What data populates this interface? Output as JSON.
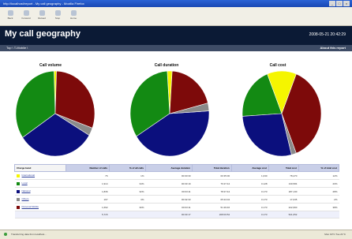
{
  "window": {
    "title": "http://localhost/report - My call geography - Mozilla Firefox",
    "controls": [
      "_",
      "□",
      "×"
    ]
  },
  "toolbar": {
    "buttons": [
      "Back",
      "Forward",
      "Reload",
      "Stop",
      "Home"
    ]
  },
  "header": {
    "title": "My call geography",
    "timestamp": "2008-05-21 20:42:29"
  },
  "nav": {
    "breadcrumb": "Top \\ T-Mobile \\",
    "about": "About this report"
  },
  "colors": {
    "International": "#f5f500",
    "Local": "#138a13",
    "National": "#0b0f7d",
    "Others": "#8a8a8a",
    "Personal Mobile": "#7d0a0a"
  },
  "chart_data": [
    {
      "type": "pie",
      "title": "Call volume",
      "series": [
        {
          "name": "International",
          "value": 1
        },
        {
          "name": "Local",
          "value": 34
        },
        {
          "name": "National",
          "value": 32
        },
        {
          "name": "Others",
          "value": 3
        },
        {
          "name": "Personal Mobile",
          "value": 30
        }
      ]
    },
    {
      "type": "pie",
      "title": "Call duration",
      "series": [
        {
          "name": "International",
          "value": 2
        },
        {
          "name": "Local",
          "value": 33
        },
        {
          "name": "National",
          "value": 42
        },
        {
          "name": "Others",
          "value": 3
        },
        {
          "name": "Personal Mobile",
          "value": 20
        }
      ]
    },
    {
      "type": "pie",
      "title": "Call cost",
      "series": [
        {
          "name": "International",
          "value": 12
        },
        {
          "name": "Local",
          "value": 20
        },
        {
          "name": "National",
          "value": 28
        },
        {
          "name": "Others",
          "value": 2
        },
        {
          "name": "Personal Mobile",
          "value": 38
        }
      ]
    }
  ],
  "table": {
    "headers": [
      "Charge band",
      "Number of calls",
      "% of all calls",
      "Average duration",
      "Total duration",
      "Average cost",
      "Total cost",
      "% of total cost"
    ],
    "rows": [
      {
        "name": "International",
        "cells": [
          "76",
          "1%",
          "00:00:30",
          "00:35:00",
          "1,030",
          "78,470",
          "12%"
        ]
      },
      {
        "name": "Local",
        "cells": [
          "1,914",
          "34%",
          "00:03:19",
          "76:27:44",
          "0.128",
          "130,584",
          "20%"
        ]
      },
      {
        "name": "National",
        "cells": [
          "1,836",
          "32%",
          "00:03:11",
          "78:27:44",
          "0.173",
          "187,130",
          "28%"
        ]
      },
      {
        "name": "Others",
        "cells": [
          "197",
          "3%",
          "00:02:33",
          "05:24:04",
          "0.173",
          "17,035",
          "2%"
        ]
      },
      {
        "name": "Personal Mobile",
        "cells": [
          "1,692",
          "30%",
          "00:03:11",
          "51:29:46",
          "0.173",
          "222,960",
          "38%"
        ]
      }
    ],
    "total": [
      "5,715",
      "",
      "00:03:17",
      "208:03:52",
      "0.173",
      "521,052",
      ""
    ]
  },
  "statusbar": {
    "text": "Transferring data from localhost...",
    "right": "Mon 19°C   Tue 21°C"
  }
}
